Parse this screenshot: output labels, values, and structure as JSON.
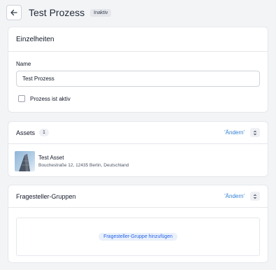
{
  "header": {
    "title": "Test Prozess",
    "status_badge": "Inaktiv"
  },
  "details": {
    "heading": "Einzelheiten",
    "name_label": "Name",
    "name_value": "Test Prozess",
    "active_checkbox_label": "Prozess ist aktiv",
    "active_checked": false
  },
  "assets": {
    "heading": "Assets",
    "count": "1",
    "change_label": "'Ändern'",
    "items": [
      {
        "name": "Test Asset",
        "address": "Bouchestraße 12, 12435 Berlin, Deutschland"
      }
    ]
  },
  "questioner_groups": {
    "heading": "Fragesteller-Gruppen",
    "change_label": "'Ändern'",
    "add_label": "Fragesteller-Gruppe hinzufügen"
  },
  "colors": {
    "link": "#2f7fd1",
    "background": "#f3f4f6"
  },
  "icons": {
    "back": "arrow-left-icon",
    "sort": "sort-icon",
    "asset_thumbnail": "building-photo"
  }
}
